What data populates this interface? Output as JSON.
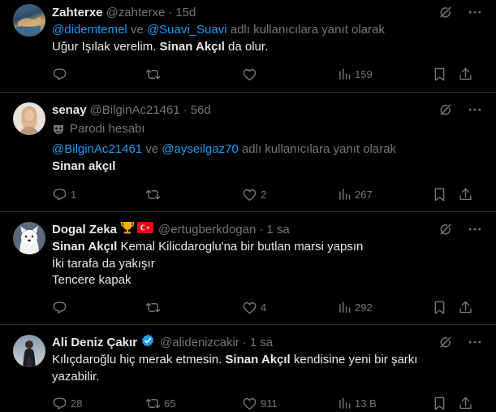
{
  "tweets": [
    {
      "name": "Zahterxe",
      "handle": "@zahterxe",
      "time": "15d",
      "reply_to": {
        "users": [
          "@didemtemel",
          "@Suavi_Suavi"
        ],
        "and": "ve",
        "suffix": "adlı kullanıcılara yanıt olarak"
      },
      "text": {
        "pre": "Uğur Işılak verelim. ",
        "bold": "Sinan Akçıl",
        "post": " da olur."
      },
      "counts": {
        "replies": "",
        "reposts": "",
        "likes": "",
        "views": "159"
      }
    },
    {
      "name": "senay",
      "handle": "@BilginAc21461",
      "time": "56d",
      "parody_label": "Parodi hesabı",
      "reply_to": {
        "users": [
          "@BilginAc21461",
          "@ayseilgaz70"
        ],
        "and": "ve",
        "suffix": "adlı kullanıcılara yanıt olarak"
      },
      "text": {
        "bold": "Sinan akçıl"
      },
      "counts": {
        "replies": "1",
        "reposts": "",
        "likes": "2",
        "views": "267"
      }
    },
    {
      "name": "Dogal Zeka",
      "handle": "@ertugberkdogan",
      "time": "1 sa",
      "badges": [
        "trophy-emoji",
        "turkey-flag"
      ],
      "text": {
        "bold": "Sinan Akçıl",
        "post": " Kemal Kilicdaroglu'na bir butlan marsi yapsın",
        "line2": "İki tarafa da yakışır",
        "line3": "Tencere kapak"
      },
      "counts": {
        "replies": "",
        "reposts": "",
        "likes": "4",
        "views": "292"
      }
    },
    {
      "name": "Ali Deniz Çakır",
      "handle": "@alidenizcakir",
      "time": "1 sa",
      "verified": true,
      "text": {
        "pre": "Kılıçdaroğlu hiç merak etmesin. ",
        "bold": "Sinan Akçıl",
        "post": " kendisine yeni bir şarkı",
        "line2": "yazabilir."
      },
      "counts": {
        "replies": "28",
        "reposts": "65",
        "likes": "911",
        "views": "13 B"
      }
    }
  ],
  "colors": {
    "background": "#000000",
    "text": "#e7e9ea",
    "muted": "#71767b",
    "link": "#1d9bf0",
    "border": "#2f3336",
    "verified": "#1d9bf0"
  },
  "icons": [
    "grok-icon",
    "more-icon",
    "reply-icon",
    "repost-icon",
    "like-icon",
    "views-icon",
    "bookmark-icon",
    "share-icon",
    "parody-mask-icon",
    "verified-badge-icon"
  ]
}
